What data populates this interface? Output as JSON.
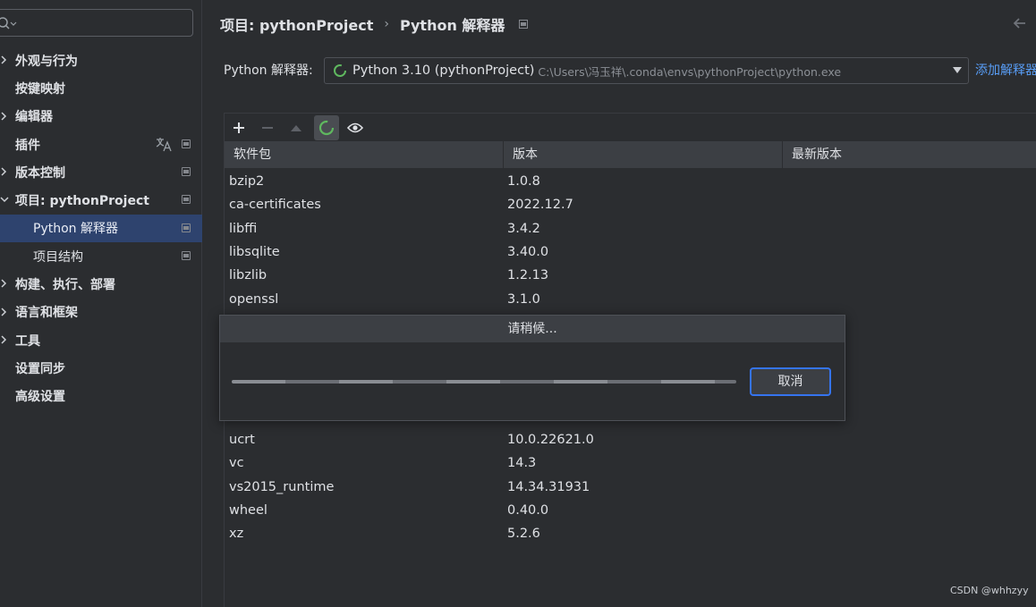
{
  "sidebar": {
    "search_placeholder": "",
    "items": [
      {
        "label": "外观与行为",
        "expandable": true
      },
      {
        "label": "按键映射"
      },
      {
        "label": "编辑器",
        "expandable": true
      },
      {
        "label": "插件",
        "translate_icon": true,
        "badge": true
      },
      {
        "label": "版本控制",
        "expandable": true,
        "badge": true
      },
      {
        "label": "项目: pythonProject",
        "expanded": true,
        "badge": true
      },
      {
        "label": "Python 解释器",
        "child": true,
        "selected": true,
        "badge": true
      },
      {
        "label": "项目结构",
        "child": true,
        "badge": true
      },
      {
        "label": "构建、执行、部署",
        "expandable": true
      },
      {
        "label": "语言和框架",
        "expandable": true
      },
      {
        "label": "工具",
        "expandable": true
      },
      {
        "label": "设置同步"
      },
      {
        "label": "高级设置"
      }
    ]
  },
  "header": {
    "breadcrumb_project": "项目: pythonProject",
    "separator": "›",
    "breadcrumb_page": "Python 解释器"
  },
  "interpreter": {
    "label": "Python 解释器:",
    "name": "Python 3.10 (pythonProject)",
    "path": "C:\\Users\\冯玉祥\\.conda\\envs\\pythonProject\\python.exe",
    "add_link": "添加解释器"
  },
  "packages": {
    "columns": [
      "软件包",
      "版本",
      "最新版本"
    ],
    "rows_top": [
      {
        "name": "bzip2",
        "version": "1.0.8"
      },
      {
        "name": "ca-certificates",
        "version": "2022.12.7"
      },
      {
        "name": "libffi",
        "version": "3.4.2"
      },
      {
        "name": "libsqlite",
        "version": "3.40.0"
      },
      {
        "name": "libzlib",
        "version": "1.2.13"
      },
      {
        "name": "openssl",
        "version": "3.1.0"
      }
    ],
    "rows_bottom": [
      {
        "name": "ucrt",
        "version": "10.0.22621.0"
      },
      {
        "name": "vc",
        "version": "14.3"
      },
      {
        "name": "vs2015_runtime",
        "version": "14.34.31931"
      },
      {
        "name": "wheel",
        "version": "0.40.0"
      },
      {
        "name": "xz",
        "version": "5.2.6"
      }
    ]
  },
  "dialog": {
    "title": "请稍候...",
    "cancel_label": "取消",
    "progress": "indeterminate"
  },
  "watermark": "CSDN @whhzyy",
  "colors": {
    "accent": "#3574f0",
    "link": "#589df6",
    "selection": "#2e436e",
    "spinner": "#5fb85f"
  }
}
